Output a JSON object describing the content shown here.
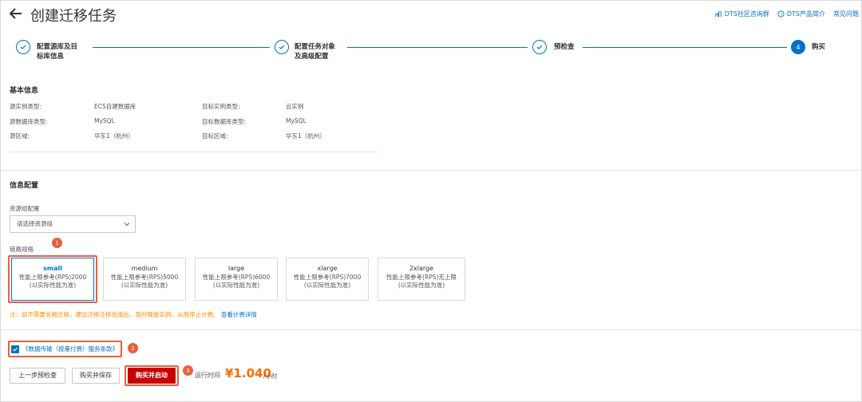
{
  "header": {
    "title": "创建迁移任务",
    "links": [
      "DTS社区咨询群",
      "DTS产品简介",
      "常见问题"
    ]
  },
  "steps": [
    {
      "label_line1": "配置源库及目",
      "label_line2": "标库信息",
      "state": "done"
    },
    {
      "label_line1": "配置任务对象",
      "label_line2": "及高级配置",
      "state": "done"
    },
    {
      "label_line1": "预检查",
      "label_line2": "",
      "state": "done"
    },
    {
      "number": "4",
      "label_line1": "购买",
      "label_line2": "",
      "state": "active"
    }
  ],
  "basic_info": {
    "title": "基本信息",
    "rows": [
      {
        "k1": "源实例类型:",
        "v1": "ECS自建数据库",
        "k2": "目标实例类型:",
        "v2": "云实例"
      },
      {
        "k1": "源数据库类型:",
        "v1": "MySQL",
        "k2": "目标数据库类型:",
        "v2": "MySQL"
      },
      {
        "k1": "源区域:",
        "v1": "华东1（杭州）",
        "k2": "目标区域:",
        "v2": "华东1（杭州）"
      }
    ]
  },
  "info_config": {
    "title": "信息配置",
    "resource_group_label": "资源组配置",
    "resource_group_placeholder": "请选择资源组",
    "spec_label": "链路规格",
    "specs": [
      {
        "name": "small",
        "line1": "性能上限参考(RPS)2000",
        "line2": "(以实际性能为准)",
        "selected": true
      },
      {
        "name": "medium",
        "line1": "性能上限参考(RPS)5000",
        "line2": "(以实际性能为准)",
        "selected": false
      },
      {
        "name": "large",
        "line1": "性能上限参考(RPS)6000",
        "line2": "(以实际性能为准)",
        "selected": false
      },
      {
        "name": "xlarge",
        "line1": "性能上限参考(RPS)7000",
        "line2": "(以实际性能为准)",
        "selected": false
      },
      {
        "name": "2xlarge",
        "line1": "性能上限参考(RPS)无上限",
        "line2": "(以实际性能为准)",
        "selected": false
      }
    ],
    "note": "注：如不需要长期迁移，建议迁移迁移完成后，及时释放实例，从而停止计费。",
    "note_link": "查看计费详情"
  },
  "agreement": {
    "text": "《数据传输（按量付费）服务条款》",
    "checked": true
  },
  "footer": {
    "prev_button": "上一步预检查",
    "save_button": "购买并保存",
    "start_button": "购买并启动",
    "runtime_label": "运行时间",
    "price": "¥1.040",
    "unit": "/小时"
  },
  "badges": [
    "1",
    "2",
    "3"
  ],
  "colors": {
    "accent": "#0070cc",
    "highlight": "#e8603c",
    "primary_button": "#c80000",
    "price": "#ff6a00",
    "note": "#ff8a00"
  }
}
